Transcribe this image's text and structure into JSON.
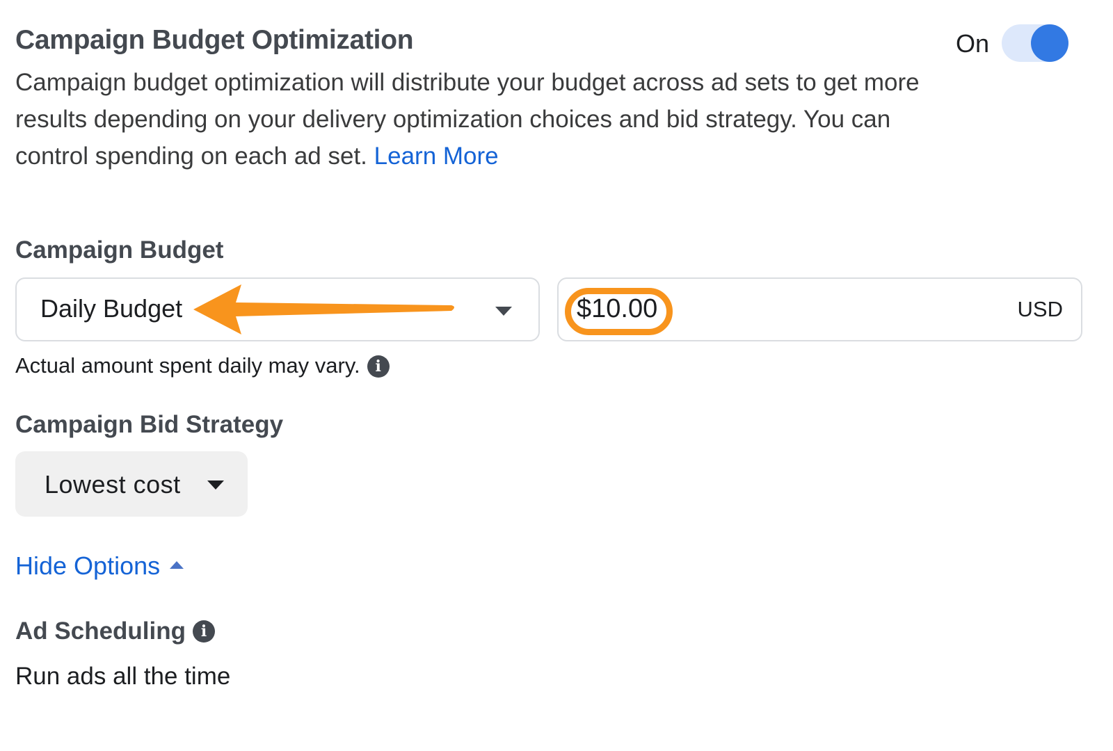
{
  "optimization": {
    "title": "Campaign Budget Optimization",
    "description": "Campaign budget optimization will distribute your budget across ad sets to get more results depending on your delivery optimization choices and bid strategy. You can control spending on each ad set.",
    "learn_more_label": "Learn More",
    "toggle_label": "On",
    "toggle_on": true
  },
  "budget": {
    "heading": "Campaign Budget",
    "type_selected": "Daily Budget",
    "amount_value": "$10.00",
    "currency": "USD",
    "note": "Actual amount spent daily may vary."
  },
  "bid_strategy": {
    "heading": "Campaign Bid Strategy",
    "selected": "Lowest cost"
  },
  "options": {
    "hide_options_label": "Hide Options"
  },
  "scheduling": {
    "heading": "Ad Scheduling",
    "value": "Run ads all the time"
  },
  "annotations": {
    "arrow_color": "#f8941d",
    "highlight_color": "#f8941d"
  },
  "icons": {
    "info": "i"
  }
}
